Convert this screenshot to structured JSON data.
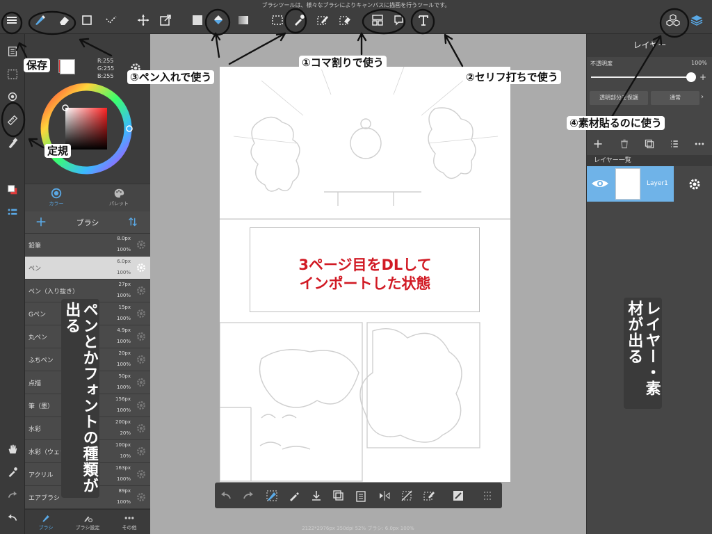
{
  "top_bar": {
    "message": "ブラシツールは、様々なブラシによりキャンバスに描画を行うツールです。"
  },
  "left_panel": {
    "color_values": {
      "r": "R:255",
      "g": "G:255",
      "b": "B:255"
    },
    "tabs": [
      {
        "label": "カラー"
      },
      {
        "label": "パレット"
      }
    ],
    "brush_header": "ブラシ",
    "brushes": [
      {
        "name": "鉛筆",
        "size": "8.0px",
        "opacity": "100%"
      },
      {
        "name": "ペン",
        "size": "6.0px",
        "opacity": "100%"
      },
      {
        "name": "ペン（入り抜き）",
        "size": "27px",
        "opacity": "100%"
      },
      {
        "name": "Gペン",
        "size": "15px",
        "opacity": "100%"
      },
      {
        "name": "丸ペン",
        "size": "4.9px",
        "opacity": "100%"
      },
      {
        "name": "ふちペン",
        "size": "20px",
        "opacity": "100%"
      },
      {
        "name": "点描",
        "size": "50px",
        "opacity": "100%"
      },
      {
        "name": "筆（墨）",
        "size": "156px",
        "opacity": "100%"
      },
      {
        "name": "水彩",
        "size": "200px",
        "opacity": "20%"
      },
      {
        "name": "水彩（ウェット）",
        "size": "100px",
        "opacity": "10%"
      },
      {
        "name": "アクリル",
        "size": "163px",
        "opacity": "100%"
      },
      {
        "name": "エアブラシ",
        "size": "89px",
        "opacity": "100%"
      }
    ],
    "bottom_tabs": [
      {
        "label": "ブラシ"
      },
      {
        "label": "ブラシ設定"
      },
      {
        "label": "その他"
      }
    ]
  },
  "right_panel": {
    "title": "レイヤー",
    "opacity_label": "不透明度",
    "opacity_value": "100%",
    "opacity_level": 1.0,
    "protect_button": "透明部分を保護",
    "blend_mode": "通常",
    "layer_list_title": "レイヤー一覧",
    "layers": [
      {
        "name": "Layer1"
      }
    ]
  },
  "status_bar": "2122*2976px 350dpi 52% ブラシ: 6.0px 100%",
  "annotations": {
    "save": "保存",
    "ruler": "定規",
    "pen_inking": "③ペン入れで使う",
    "panel_split": "①コマ割りで使う",
    "speech": "②セリフ打ちで使う",
    "materials": "④素材貼るのに使う",
    "canvas_note_1": "3ページ目をDLして",
    "canvas_note_2": "インポートした状態",
    "left_vertical": "ペンとかフォントの種類が出る",
    "right_vertical": "レイヤー・素材が出る"
  },
  "colors": {
    "accent_blue": "#5aa9e6",
    "annotation_red": "#d11a24"
  }
}
